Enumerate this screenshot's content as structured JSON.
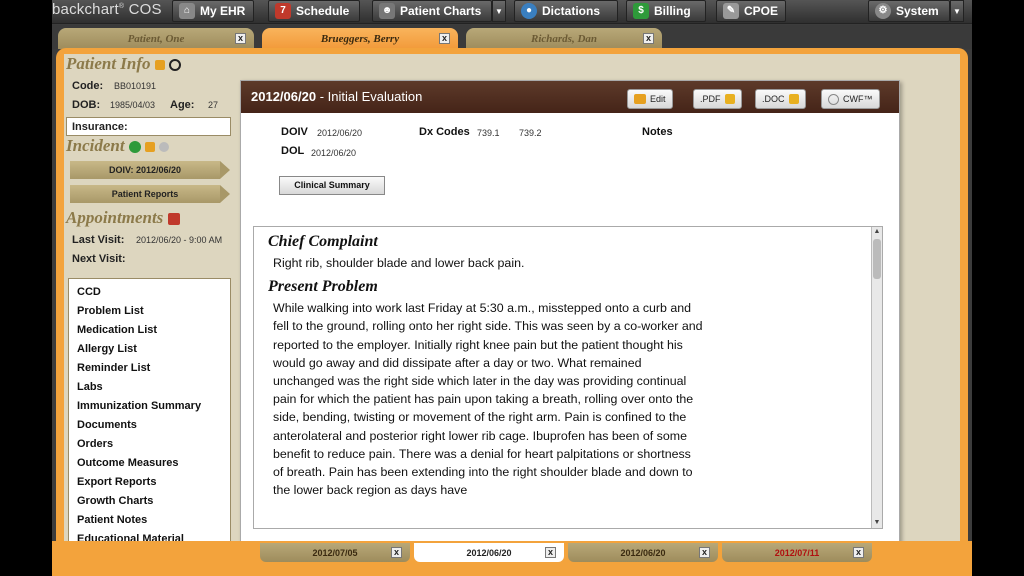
{
  "nav": {
    "brand": "backchart",
    "brand_suffix": "COS",
    "buttons": [
      {
        "label": "My EHR",
        "icon": "home-icon"
      },
      {
        "label": "Schedule",
        "icon": "calendar-icon"
      },
      {
        "label": "Patient Charts",
        "icon": "person-icon"
      },
      {
        "label": "Dictations",
        "icon": "speech-bubble-icon"
      },
      {
        "label": "Billing",
        "icon": "dollar-icon"
      },
      {
        "label": "CPOE",
        "icon": "document-icon"
      },
      {
        "label": "System",
        "icon": "gear-icon"
      }
    ]
  },
  "patient_tabs": [
    {
      "label": "Patient, One",
      "close": "x"
    },
    {
      "label": "Brueggers, Berry",
      "close": "x"
    },
    {
      "label": "Richards, Dan",
      "close": "x"
    }
  ],
  "sidebar": {
    "patient_info_title": "Patient Info",
    "code_label": "Code:",
    "code_value": "BB010191",
    "dob_label": "DOB:",
    "dob_value": "1985/04/03",
    "age_label": "Age:",
    "age_value": "27",
    "insurance_label": "Insurance:",
    "incident_title": "Incident",
    "doiv_button": "DOIV: 2012/06/20",
    "patient_reports_button": "Patient Reports",
    "appointments_title": "Appointments",
    "last_visit_label": "Last Visit:",
    "last_visit_value": "2012/06/20 - 9:00 AM",
    "next_visit_label": "Next Visit:",
    "list_items": [
      "CCD",
      "Problem List",
      "Medication List",
      "Allergy List",
      "Reminder List",
      "Labs",
      "Immunization Summary",
      "Documents",
      "Orders",
      "Outcome Measures",
      "Export Reports",
      "Growth Charts",
      "Patient Notes",
      "Educational Material"
    ]
  },
  "panel": {
    "date": "2012/06/20",
    "title_suffix": " - Initial Evaluation",
    "edit_label": "Edit",
    "pdf_label": ".PDF",
    "doc_label": ".DOC",
    "cwf_label": "CWF™",
    "doiv_label": "DOIV",
    "doiv_value": "2012/06/20",
    "dol_label": "DOL",
    "dol_value": "2012/06/20",
    "dx_label": "Dx Codes",
    "dx_codes": [
      "739.1",
      "739.2"
    ],
    "notes_label": "Notes",
    "clinical_summary_button": "Clinical Summary",
    "chief_complaint_heading": "Chief Complaint",
    "chief_complaint_text": "Right rib, shoulder blade and lower back pain.",
    "present_problem_heading": "Present Problem",
    "present_problem_text": "While walking into work last Friday at 5:30 a.m., misstepped onto a curb and fell to the ground, rolling onto her right side. This was seen by a co-worker and reported to the employer. Initially right knee pain but the patient thought his would go away and did dissipate after a day or two. What remained unchanged was the right side which later in the day was providing continual pain for which the patient has pain upon taking a breath, rolling over onto the side, bending, twisting or movement of the right arm. Pain is confined to the anterolateral and posterior right lower rib cage. Ibuprofen has been of some benefit to reduce pain. There was a denial for heart palpitations or shortness of breath. Pain has been extending into the right shoulder blade and down to the lower back region as days have"
  },
  "date_tabs": [
    {
      "label": "2012/07/05",
      "close": "x"
    },
    {
      "label": "2012/06/20",
      "close": "x"
    },
    {
      "label": "2012/06/20",
      "close": "x"
    },
    {
      "label": "2012/07/11",
      "close": "x"
    }
  ],
  "colors": {
    "accent_orange": "#f3a33c",
    "header_brown": "#4f2d20",
    "sidebar_bg": "#ddd6bf",
    "title_tan": "#8c7a4a"
  }
}
